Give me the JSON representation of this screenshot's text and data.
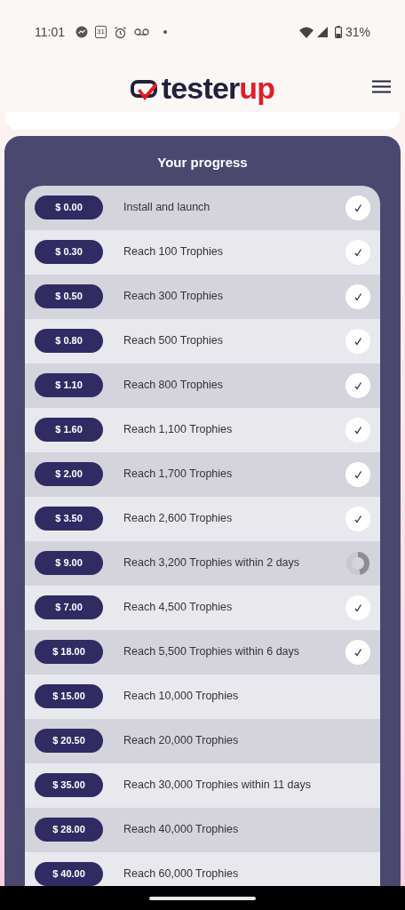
{
  "status_bar": {
    "time": "11:01",
    "calendar_day": "31",
    "battery": "31%"
  },
  "header": {
    "logo": {
      "main": "tester",
      "accent": "up"
    }
  },
  "progress": {
    "title": "Your progress",
    "rows": [
      {
        "reward": "$ 0.00",
        "task": "Install and launch",
        "kind": "done"
      },
      {
        "reward": "$ 0.30",
        "task": "Reach 100 Trophies",
        "kind": "done"
      },
      {
        "reward": "$ 0.50",
        "task": "Reach 300 Trophies",
        "kind": "done"
      },
      {
        "reward": "$ 0.80",
        "task": "Reach 500 Trophies",
        "kind": "done"
      },
      {
        "reward": "$ 1.10",
        "task": "Reach 800 Trophies",
        "kind": "done"
      },
      {
        "reward": "$ 1.60",
        "task": "Reach 1,100 Trophies",
        "kind": "done"
      },
      {
        "reward": "$ 2.00",
        "task": "Reach 1,700 Trophies",
        "kind": "done"
      },
      {
        "reward": "$ 3.50",
        "task": "Reach 2,600 Trophies",
        "kind": "done"
      },
      {
        "reward": "$ 9.00",
        "task": "Reach 3,200 Trophies within 2 days",
        "kind": "progress"
      },
      {
        "reward": "$ 7.00",
        "task": "Reach 4,500 Trophies",
        "kind": "done"
      },
      {
        "reward": "$ 18.00",
        "task": "Reach 5,500 Trophies within 6 days",
        "kind": "done"
      },
      {
        "reward": "$ 15.00",
        "task": "Reach 10,000 Trophies",
        "kind": "open"
      },
      {
        "reward": "$ 20.50",
        "task": "Reach 20,000 Trophies",
        "kind": "open"
      },
      {
        "reward": "$ 35.00",
        "task": "Reach 30,000 Trophies within 11 days",
        "kind": "open"
      },
      {
        "reward": "$ 28.00",
        "task": "Reach 40,000 Trophies",
        "kind": "open"
      },
      {
        "reward": "$ 40.00",
        "task": "Reach 60,000 Trophies",
        "kind": "open"
      }
    ]
  }
}
